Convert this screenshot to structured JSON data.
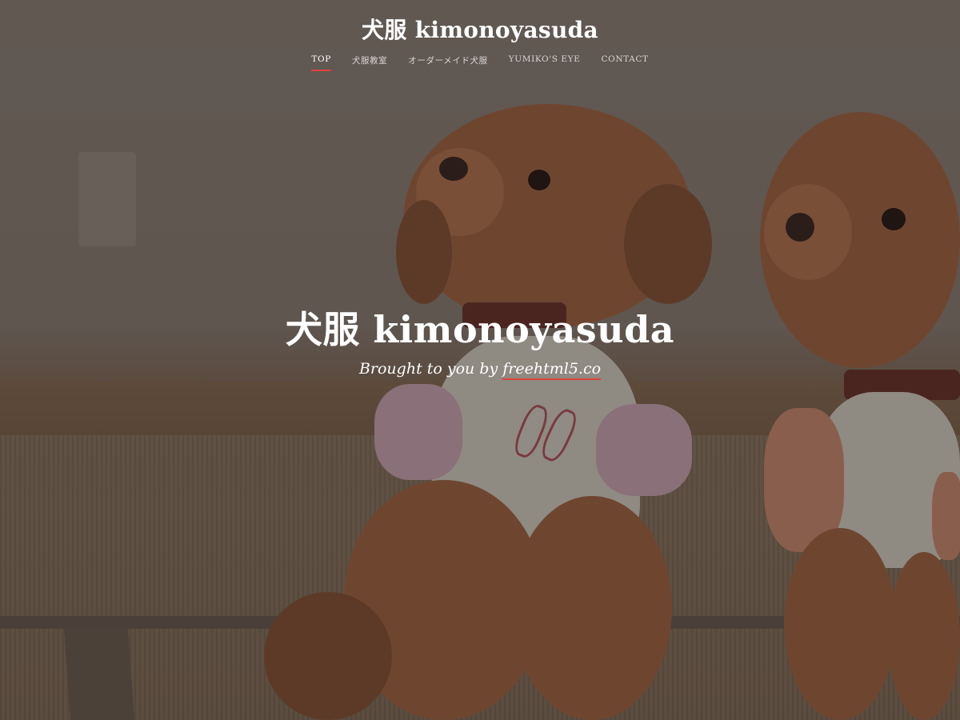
{
  "site": {
    "logo": "犬服 kimonoyasuda"
  },
  "nav": {
    "items": [
      {
        "label": "TOP",
        "active": true
      },
      {
        "label": "犬服教室",
        "active": false
      },
      {
        "label": "オーダーメイド犬服",
        "active": false
      },
      {
        "label": "YUMIKO'S EYE",
        "active": false
      },
      {
        "label": "CONTACT",
        "active": false
      }
    ]
  },
  "hero": {
    "title": "犬服 kimonoyasuda",
    "subtitle_prefix": "Brought to you by ",
    "subtitle_link": "freehtml5.co"
  },
  "colors": {
    "accent": "#e0403c",
    "text": "#ffffff"
  }
}
